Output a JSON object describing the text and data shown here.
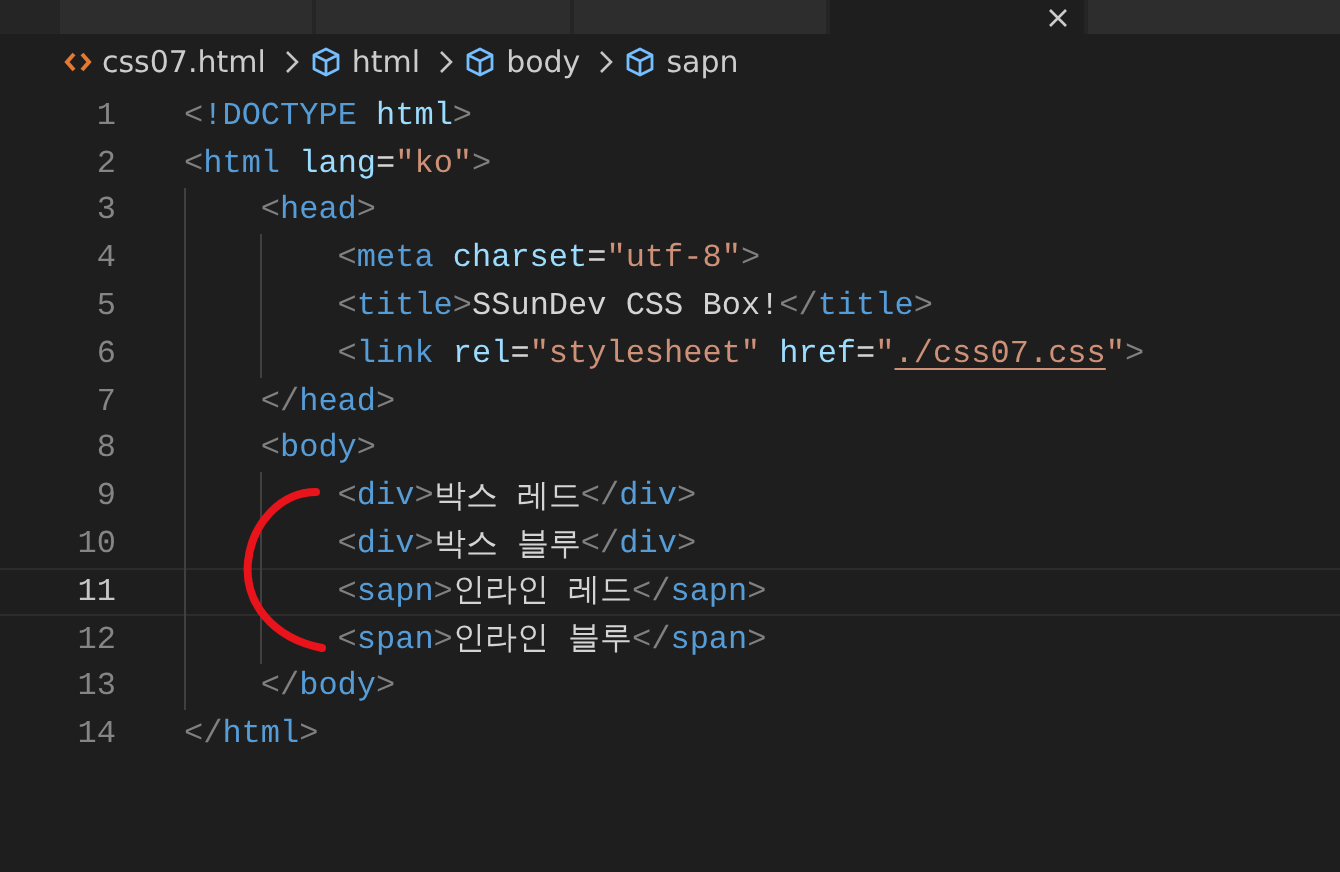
{
  "tabs": [
    {
      "selected": false
    },
    {
      "selected": false
    },
    {
      "selected": false
    },
    {
      "selected": true
    },
    {
      "selected": false
    }
  ],
  "breadcrumb": [
    {
      "kind": "file",
      "label": "css07.html"
    },
    {
      "kind": "element",
      "label": "html"
    },
    {
      "kind": "element",
      "label": "body"
    },
    {
      "kind": "element",
      "label": "sapn"
    }
  ],
  "editor": {
    "lines": [
      {
        "number": "1",
        "current": false,
        "tokens": [
          {
            "kind": "punct",
            "text": "<"
          },
          {
            "kind": "tag",
            "text": "!DOCTYPE"
          },
          {
            "kind": "attr",
            "text": "html",
            "space_before": true
          },
          {
            "kind": "punct",
            "text": ">"
          }
        ]
      },
      {
        "number": "2",
        "current": false,
        "tokens": [
          {
            "kind": "punct",
            "text": "<"
          },
          {
            "kind": "tag",
            "text": "html"
          },
          {
            "kind": "attr",
            "text": "lang",
            "space_before": true
          },
          {
            "kind": "text",
            "text": "="
          },
          {
            "kind": "string",
            "text": "\"ko\""
          },
          {
            "kind": "punct",
            "text": ">"
          }
        ],
        "children": [
          {
            "number": "3",
            "current": false,
            "tokens": [
              {
                "kind": "punct",
                "text": "<"
              },
              {
                "kind": "tag",
                "text": "head"
              },
              {
                "kind": "punct",
                "text": ">"
              }
            ],
            "children": [
              {
                "number": "4",
                "current": false,
                "tokens": [
                  {
                    "kind": "punct",
                    "text": "<"
                  },
                  {
                    "kind": "tag",
                    "text": "meta"
                  },
                  {
                    "kind": "attr",
                    "text": "charset",
                    "space_before": true
                  },
                  {
                    "kind": "text",
                    "text": "="
                  },
                  {
                    "kind": "string",
                    "text": "\"utf-8\""
                  },
                  {
                    "kind": "punct",
                    "text": ">"
                  }
                ]
              },
              {
                "number": "5",
                "current": false,
                "tokens": [
                  {
                    "kind": "punct",
                    "text": "<"
                  },
                  {
                    "kind": "tag",
                    "text": "title"
                  },
                  {
                    "kind": "punct",
                    "text": ">"
                  },
                  {
                    "kind": "text",
                    "text": "SSunDev CSS Box!"
                  },
                  {
                    "kind": "punct",
                    "text": "</"
                  },
                  {
                    "kind": "tag",
                    "text": "title"
                  },
                  {
                    "kind": "punct",
                    "text": ">"
                  }
                ]
              },
              {
                "number": "6",
                "current": false,
                "tokens": [
                  {
                    "kind": "punct",
                    "text": "<"
                  },
                  {
                    "kind": "tag",
                    "text": "link"
                  },
                  {
                    "kind": "attr",
                    "text": "rel",
                    "space_before": true
                  },
                  {
                    "kind": "text",
                    "text": "="
                  },
                  {
                    "kind": "string",
                    "text": "\"stylesheet\""
                  },
                  {
                    "kind": "attr",
                    "text": "href",
                    "space_before": true
                  },
                  {
                    "kind": "text",
                    "text": "="
                  },
                  {
                    "kind": "string",
                    "text": "\""
                  },
                  {
                    "kind": "link",
                    "text": "./css07.css"
                  },
                  {
                    "kind": "string",
                    "text": "\""
                  },
                  {
                    "kind": "punct",
                    "text": ">"
                  }
                ]
              }
            ]
          },
          {
            "number": "7",
            "current": false,
            "tokens": [
              {
                "kind": "punct",
                "text": "</"
              },
              {
                "kind": "tag",
                "text": "head"
              },
              {
                "kind": "punct",
                "text": ">"
              }
            ]
          },
          {
            "number": "8",
            "current": false,
            "tokens": [
              {
                "kind": "punct",
                "text": "<"
              },
              {
                "kind": "tag",
                "text": "body"
              },
              {
                "kind": "punct",
                "text": ">"
              }
            ],
            "children": [
              {
                "number": "9",
                "current": false,
                "tokens": [
                  {
                    "kind": "punct",
                    "text": "<"
                  },
                  {
                    "kind": "tag",
                    "text": "div"
                  },
                  {
                    "kind": "punct",
                    "text": ">"
                  },
                  {
                    "kind": "text",
                    "text": "박스 레드"
                  },
                  {
                    "kind": "punct",
                    "text": "</"
                  },
                  {
                    "kind": "tag",
                    "text": "div"
                  },
                  {
                    "kind": "punct",
                    "text": ">"
                  }
                ]
              },
              {
                "number": "10",
                "current": false,
                "tokens": [
                  {
                    "kind": "punct",
                    "text": "<"
                  },
                  {
                    "kind": "tag",
                    "text": "div"
                  },
                  {
                    "kind": "punct",
                    "text": ">"
                  },
                  {
                    "kind": "text",
                    "text": "박스 블루"
                  },
                  {
                    "kind": "punct",
                    "text": "</"
                  },
                  {
                    "kind": "tag",
                    "text": "div"
                  },
                  {
                    "kind": "punct",
                    "text": ">"
                  }
                ]
              },
              {
                "number": "11",
                "current": true,
                "tokens": [
                  {
                    "kind": "punct",
                    "text": "<"
                  },
                  {
                    "kind": "tag",
                    "text": "sapn"
                  },
                  {
                    "kind": "punct",
                    "text": ">"
                  },
                  {
                    "kind": "text",
                    "text": "인라인 레드"
                  },
                  {
                    "kind": "punct",
                    "text": "</"
                  },
                  {
                    "kind": "tag",
                    "text": "sapn"
                  },
                  {
                    "kind": "punct",
                    "text": ">"
                  }
                ]
              },
              {
                "number": "12",
                "current": false,
                "tokens": [
                  {
                    "kind": "punct",
                    "text": "<"
                  },
                  {
                    "kind": "tag",
                    "text": "span"
                  },
                  {
                    "kind": "punct",
                    "text": ">"
                  },
                  {
                    "kind": "text",
                    "text": "인라인 블루"
                  },
                  {
                    "kind": "punct",
                    "text": "</"
                  },
                  {
                    "kind": "tag",
                    "text": "span"
                  },
                  {
                    "kind": "punct",
                    "text": ">"
                  }
                ]
              }
            ]
          },
          {
            "number": "13",
            "current": false,
            "tokens": [
              {
                "kind": "punct",
                "text": "</"
              },
              {
                "kind": "tag",
                "text": "body"
              },
              {
                "kind": "punct",
                "text": ">"
              }
            ]
          }
        ]
      },
      {
        "number": "14",
        "current": false,
        "tokens": [
          {
            "kind": "punct",
            "text": "</"
          },
          {
            "kind": "tag",
            "text": "html"
          },
          {
            "kind": "punct",
            "text": ">"
          }
        ]
      }
    ]
  }
}
